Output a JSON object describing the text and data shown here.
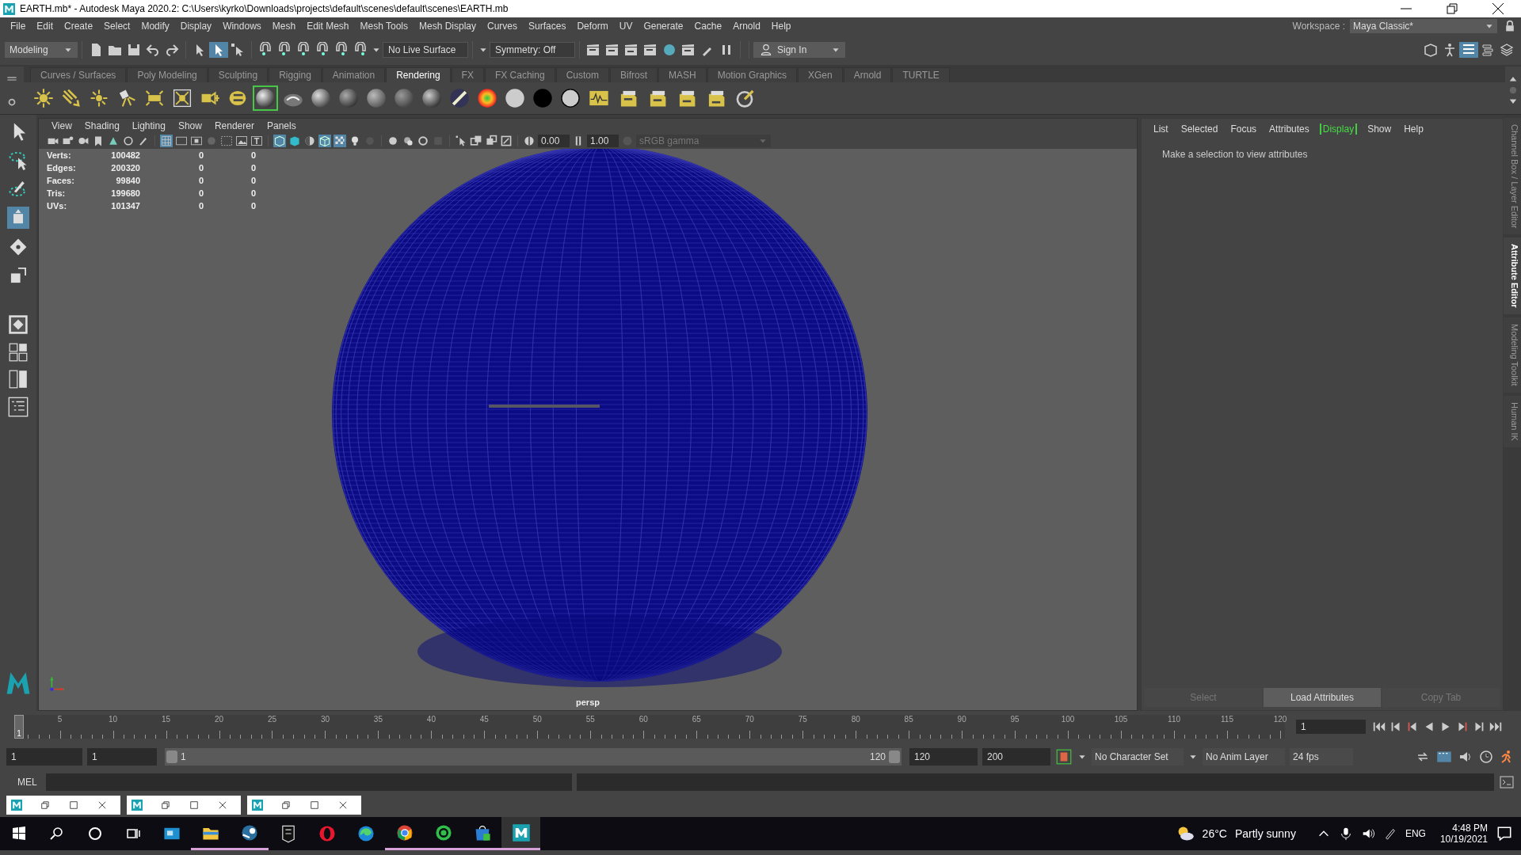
{
  "window": {
    "title": "EARTH.mb* - Autodesk Maya 2020.2: C:\\Users\\kyrko\\Downloads\\projects\\default\\scenes\\default\\scenes\\EARTH.mb"
  },
  "menu": [
    "File",
    "Edit",
    "Create",
    "Select",
    "Modify",
    "Display",
    "Windows",
    "Mesh",
    "Edit Mesh",
    "Mesh Tools",
    "Mesh Display",
    "Curves",
    "Surfaces",
    "Deform",
    "UV",
    "Generate",
    "Cache",
    "Arnold",
    "Help"
  ],
  "workspace": {
    "label": "Workspace :",
    "value": "Maya Classic*"
  },
  "status_line": {
    "mode": "Modeling",
    "live_surface": "No Live Surface",
    "symmetry": "Symmetry: Off",
    "sign_in": "Sign In"
  },
  "shelf_tabs": [
    {
      "label": "Curves / Surfaces",
      "selected": false
    },
    {
      "label": "Poly Modeling",
      "selected": false
    },
    {
      "label": "Sculpting",
      "selected": false
    },
    {
      "label": "Rigging",
      "selected": false
    },
    {
      "label": "Animation",
      "selected": false
    },
    {
      "label": "Rendering",
      "selected": true
    },
    {
      "label": "FX",
      "selected": false
    },
    {
      "label": "FX Caching",
      "selected": false
    },
    {
      "label": "Custom",
      "selected": false
    },
    {
      "label": "Bifrost",
      "selected": false
    },
    {
      "label": "MASH",
      "selected": false
    },
    {
      "label": "Motion Graphics",
      "selected": false
    },
    {
      "label": "XGen",
      "selected": false
    },
    {
      "label": "Arnold",
      "selected": false
    },
    {
      "label": "TURTLE",
      "selected": false
    }
  ],
  "viewport": {
    "menu": [
      "View",
      "Shading",
      "Lighting",
      "Show",
      "Renderer",
      "Panels"
    ],
    "exposure": "0.00",
    "gamma": "1.00",
    "color_space": "sRGB gamma",
    "camera": "persp",
    "hud": [
      {
        "label": "Verts:",
        "values": [
          "100482",
          "0",
          "0"
        ]
      },
      {
        "label": "Edges:",
        "values": [
          "200320",
          "0",
          "0"
        ]
      },
      {
        "label": "Faces:",
        "values": [
          "99840",
          "0",
          "0"
        ]
      },
      {
        "label": "Tris:",
        "values": [
          "199680",
          "0",
          "0"
        ]
      },
      {
        "label": "UVs:",
        "values": [
          "101347",
          "0",
          "0"
        ]
      }
    ]
  },
  "attribute_editor": {
    "menu": [
      {
        "label": "List",
        "selected": false
      },
      {
        "label": "Selected",
        "selected": false
      },
      {
        "label": "Focus",
        "selected": false
      },
      {
        "label": "Attributes",
        "selected": false
      },
      {
        "label": "Display",
        "selected": true
      },
      {
        "label": "Show",
        "selected": false
      },
      {
        "label": "Help",
        "selected": false
      }
    ],
    "message": "Make a selection to view attributes",
    "buttons": [
      {
        "label": "Select",
        "disabled": true
      },
      {
        "label": "Load Attributes",
        "disabled": false
      },
      {
        "label": "Copy Tab",
        "disabled": true
      }
    ]
  },
  "side_tabs": [
    {
      "label": "Channel Box / Layer Editor",
      "selected": false
    },
    {
      "label": "Attribute Editor",
      "selected": true
    },
    {
      "label": "Modeling Toolkit",
      "selected": false
    },
    {
      "label": "Human IK",
      "selected": false
    }
  ],
  "timeline": {
    "ticks": [
      "5",
      "10",
      "15",
      "20",
      "25",
      "30",
      "35",
      "40",
      "45",
      "50",
      "55",
      "60",
      "65",
      "70",
      "75",
      "80",
      "85",
      "90",
      "95",
      "100",
      "105",
      "110",
      "115",
      "120"
    ],
    "current_frame": "1",
    "level": 0,
    "frame_field": "1"
  },
  "range": {
    "start": "1",
    "playback_start": "1",
    "slider_start": "1",
    "slider_end": "120",
    "level": 1,
    "playback_end": "120",
    "end": "200",
    "character_set": "No Character Set",
    "anim_layer": "No Anim Layer",
    "fps": "24 fps"
  },
  "command_line": {
    "label": "MEL"
  },
  "minimized_windows": [
    {
      "kind": "maya"
    },
    {
      "kind": "maya"
    },
    {
      "kind": "maya"
    }
  ],
  "taskbar": {
    "apps": [
      {
        "kind": "photos",
        "running": false
      },
      {
        "kind": "explorer",
        "running": true
      },
      {
        "kind": "steam",
        "running": true
      },
      {
        "kind": "epic",
        "running": false
      },
      {
        "kind": "opera",
        "running": false
      },
      {
        "kind": "edge",
        "running": false
      },
      {
        "kind": "chrome",
        "running": true
      },
      {
        "kind": "green",
        "running": true
      },
      {
        "kind": "store",
        "running": true
      },
      {
        "kind": "maya",
        "running": true
      }
    ],
    "temperature": "26°C",
    "weather": "Partly sunny",
    "language": "ENG",
    "time": "4:48 PM",
    "date": "10/19/2021"
  }
}
